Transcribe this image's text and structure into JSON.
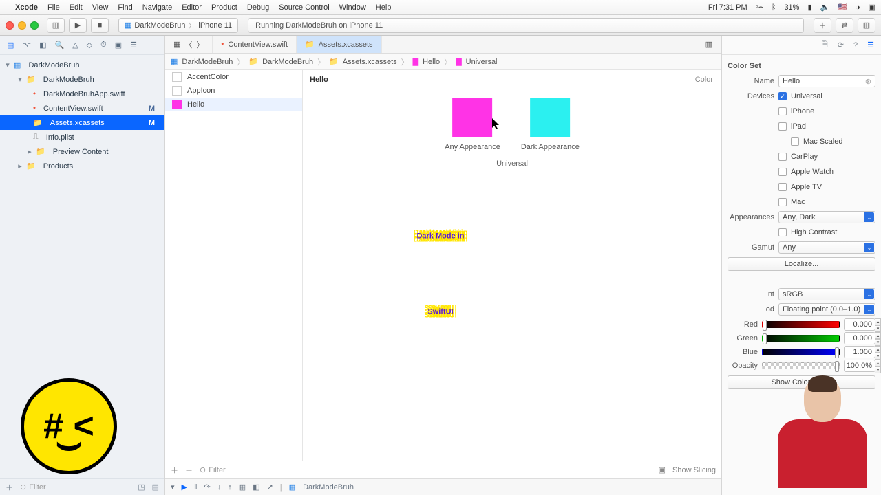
{
  "menubar": {
    "app": "Xcode",
    "items": [
      "File",
      "Edit",
      "View",
      "Find",
      "Navigate",
      "Editor",
      "Product",
      "Debug",
      "Source Control",
      "Window",
      "Help"
    ],
    "clock": "Fri 7:31 PM",
    "battery": "31%"
  },
  "toolbar": {
    "scheme_app": "DarkModeBruh",
    "scheme_device": "iPhone 11",
    "status": "Running DarkModeBruh on iPhone 11"
  },
  "tabs": {
    "a": "ContentView.swift",
    "b": "Assets.xcassets"
  },
  "jump": {
    "a": "DarkModeBruh",
    "b": "DarkModeBruh",
    "c": "Assets.xcassets",
    "d": "Hello",
    "e": "Universal"
  },
  "navigator": {
    "root": "DarkModeBruh",
    "group": "DarkModeBruh",
    "files": {
      "app": "DarkModeBruhApp.swift",
      "content": "ContentView.swift",
      "assets": "Assets.xcassets",
      "info": "Info.plist",
      "preview": "Preview Content"
    },
    "products": "Products",
    "m": "M",
    "filter_ph": "Filter"
  },
  "assets": {
    "list": {
      "accent": "AccentColor",
      "appicon": "AppIcon",
      "hello": "Hello"
    },
    "header": "Hello",
    "type": "Color",
    "any": "Any Appearance",
    "dark": "Dark Appearance",
    "set": "Universal",
    "slicing": "Show Slicing",
    "filter_ph": "Filter",
    "swatch_any": "#ff33e6",
    "swatch_dark": "#2bf0f0"
  },
  "inspector": {
    "section": "Color Set",
    "labels": {
      "name": "Name",
      "devices": "Devices",
      "appearances": "Appearances",
      "gamut": "Gamut",
      "localize": "Localize...",
      "content": "sRGB",
      "method": "Floating point (0.0–1.0)",
      "red": "Red",
      "green": "Green",
      "blue": "Blue",
      "opacity": "Opacity",
      "showpanel": "Show Color Panel"
    },
    "name_value": "Hello",
    "devices": {
      "universal": "Universal",
      "iphone": "iPhone",
      "ipad": "iPad",
      "macscaled": "Mac Scaled",
      "carplay": "CarPlay",
      "watch": "Apple Watch",
      "tv": "Apple TV",
      "mac": "Mac"
    },
    "appearances_value": "Any, Dark",
    "highcontrast": "High Contrast",
    "gamut_value": "Any",
    "values": {
      "red": "0.000",
      "green": "0.000",
      "blue": "1.000",
      "opacity": "100.0%"
    },
    "content_label": "nt",
    "method_label": "od"
  },
  "debug": {
    "target": "DarkModeBruh"
  },
  "overlay": {
    "l1": "Dark Mode in",
    "l2": "SwiftUI"
  }
}
